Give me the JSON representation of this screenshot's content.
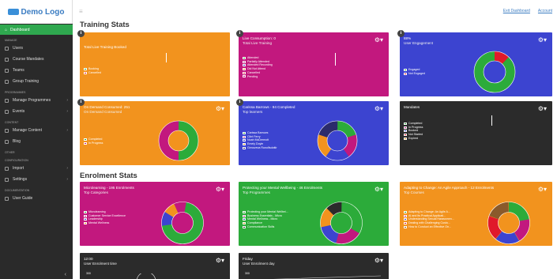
{
  "app": {
    "logo": "Demo Logo"
  },
  "topbar": {
    "exit": "Exit Dashboard",
    "account": "Account"
  },
  "sidebar": {
    "active": "Dashboard",
    "sections": [
      {
        "label": "MANAGE",
        "items": [
          {
            "label": "Users"
          },
          {
            "label": "Course Mandates"
          },
          {
            "label": "Teams"
          },
          {
            "label": "Group Training"
          }
        ]
      },
      {
        "label": "PROGRAMMES",
        "items": [
          {
            "label": "Manage Programmes",
            "chev": "›"
          },
          {
            "label": "Events",
            "chev": "›"
          }
        ]
      },
      {
        "label": "CONTENT",
        "items": [
          {
            "label": "Manage Content",
            "chev": "›"
          },
          {
            "label": "Blog"
          }
        ]
      },
      {
        "label": "OTHER",
        "items": []
      },
      {
        "label": "CONFIGURATION",
        "items": [
          {
            "label": "Import",
            "chev": "›"
          },
          {
            "label": "Settings",
            "chev": "›"
          }
        ]
      },
      {
        "label": "DOCUMENTATION",
        "items": [
          {
            "label": "User Guide"
          }
        ]
      }
    ],
    "collapse": "‹"
  },
  "sections": {
    "training": "Training Stats",
    "enrolment": "Enrolment Stats"
  },
  "cards": {
    "live_training": {
      "title": "Total Live Training Booked",
      "legend": [
        "Booking",
        "Cancelled"
      ]
    },
    "live_consumption": {
      "title": "Live Consumption: 0",
      "subtitle": "Total Live Training",
      "legend": [
        "Attended",
        "Partially Attended",
        "Attended Recording",
        "Did Not Attend",
        "Cancelled",
        "Pending"
      ]
    },
    "engagement": {
      "title": "88%",
      "subtitle": "User Engagement",
      "legend": [
        "Engaged",
        "Not Engaged"
      ]
    },
    "on_demand": {
      "title": "On Demand Consumed: 251",
      "subtitle": "On Demand Consumed",
      "legend": [
        "Completed",
        "In Progress"
      ]
    },
    "carissa": {
      "title": "Carissa Barrows - 94 Completed",
      "subtitle": "Top learners",
      "legend": [
        "Carissa Barrows",
        "Clint Ferry",
        "Noah McDermott",
        "Emely Doyle",
        "Genoveva Runolfsdottir"
      ]
    },
    "mandates": {
      "title": "Mandates",
      "legend": [
        "Completed",
        "In Progress",
        "Booked",
        "Not Started",
        "Expired"
      ]
    },
    "microlearning": {
      "title": "Microlearning - 195 Enrolments",
      "subtitle": "Top Categories",
      "legend": [
        "Microlearning",
        "Customer Service Excellence",
        "Leadership",
        "Mental Wellness"
      ]
    },
    "protecting": {
      "title": "Protecting your Mental Wellbeing - 46 Enrolments",
      "subtitle": "Top Programmes",
      "legend": [
        "Protecting your Mental Wellbei...",
        "Business Essentials - Micro",
        "Mental Wellness - Micro",
        "Compliance",
        "Communication Skills"
      ]
    },
    "adapting": {
      "title": "Adapting to Change: An Agile Approach - 12 Enrolments",
      "subtitle": "Top Courses",
      "legend": [
        "Adapting to Change: An Agile A...",
        "AI and its Practical Applicati...",
        "Understanding Sexual Harassmen...",
        "Dealing with Challenging Custo...",
        "How to Conduct an Effective On..."
      ]
    },
    "time": {
      "title": "12:00",
      "subtitle": "User Enrolment time",
      "axis": "300"
    },
    "day": {
      "title": "Friday",
      "subtitle": "User Enrolment day",
      "axis": "300"
    }
  },
  "icons": {
    "gear": "gear-icon",
    "info": "info-icon"
  }
}
